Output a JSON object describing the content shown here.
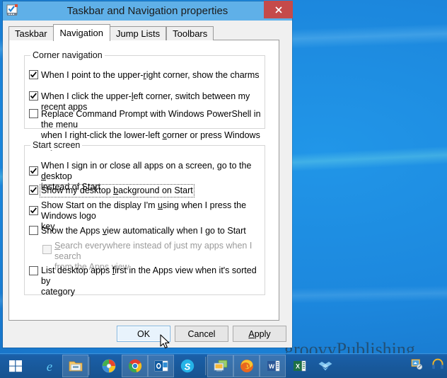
{
  "window": {
    "title": "Taskbar and Navigation properties",
    "app_icon": "taskbar-properties-icon",
    "close_label": "✕"
  },
  "tabs": [
    {
      "label": "Taskbar",
      "active": false
    },
    {
      "label": "Navigation",
      "active": true
    },
    {
      "label": "Jump Lists",
      "active": false
    },
    {
      "label": "Toolbars",
      "active": false
    }
  ],
  "groups": {
    "corner_navigation": {
      "title": "Corner navigation",
      "options": [
        {
          "name": "upper-right-charms",
          "pre": "When I point to the upper-",
          "mnemonic": "r",
          "post": "ight corner, show the charms",
          "checked": true,
          "enabled": true,
          "focused": false
        },
        {
          "name": "upper-left-switch-apps",
          "pre": "When I click the upper-",
          "mnemonic": "l",
          "post": "eft corner, switch between my recent apps",
          "checked": true,
          "enabled": true,
          "focused": false
        },
        {
          "name": "replace-command-prompt-powershell",
          "pre": "Replace Command Prompt with Windows PowerShell in the menu\nwhen I right-click the lower-left ",
          "mnemonic": "c",
          "post": "orner or press Windows key +X",
          "checked": false,
          "enabled": true,
          "focused": false
        }
      ]
    },
    "start_screen": {
      "title": "Start screen",
      "options": [
        {
          "name": "sign-in-go-to-desktop",
          "pre": "When I sign in or close all apps on a screen, go to the ",
          "mnemonic": "d",
          "post": "esktop\ninstead of Start",
          "checked": true,
          "enabled": true,
          "focused": false
        },
        {
          "name": "show-desktop-background-on-start",
          "pre": "Show my desktop ",
          "mnemonic": "b",
          "post": "ackground on Start",
          "checked": true,
          "enabled": true,
          "focused": true
        },
        {
          "name": "show-start-on-display-in-use",
          "pre": "Show Start on the display I'm ",
          "mnemonic": "u",
          "post": "sing when I press the Windows logo\nkey",
          "checked": true,
          "enabled": true,
          "focused": false
        },
        {
          "name": "show-apps-view-automatically",
          "pre": "Show the Apps ",
          "mnemonic": "v",
          "post": "iew automatically when I go to Start",
          "checked": false,
          "enabled": true,
          "focused": false
        },
        {
          "name": "search-everywhere",
          "pre": "",
          "mnemonic": "S",
          "post": "earch everywhere instead of just my apps when I search\nfrom the Apps view",
          "checked": false,
          "enabled": false,
          "focused": false,
          "indented": true
        },
        {
          "name": "list-desktop-apps-first",
          "pre": "List desktop apps ",
          "mnemonic": "f",
          "post": "irst in the Apps view when it's sorted by\ncategory",
          "checked": false,
          "enabled": true,
          "focused": false
        }
      ]
    }
  },
  "buttons": {
    "ok": "OK",
    "cancel": "Cancel",
    "apply_pre": "",
    "apply_mnemonic": "A",
    "apply_post": "pply"
  },
  "desktop": {
    "watermark": "groovyPublishing"
  },
  "taskbar": {
    "start_icon": "windows-start-icon",
    "items": [
      {
        "name": "internet-explorer-icon",
        "pinned": false
      },
      {
        "name": "file-explorer-icon",
        "pinned": true
      },
      {
        "name": "windows-media-center-icon",
        "pinned": false
      },
      {
        "name": "google-chrome-icon",
        "pinned": true
      },
      {
        "name": "outlook-icon",
        "pinned": true
      },
      {
        "name": "skype-icon",
        "pinned": false
      },
      {
        "name": "remote-desktop-icon",
        "pinned": true
      },
      {
        "name": "firefox-icon",
        "pinned": true
      },
      {
        "name": "word-icon",
        "pinned": true
      },
      {
        "name": "excel-icon",
        "pinned": false
      },
      {
        "name": "dropbox-icon",
        "pinned": false
      }
    ],
    "tray": [
      {
        "name": "tray-paint-icon"
      },
      {
        "name": "tray-headset-icon"
      }
    ]
  },
  "colors": {
    "window_frame": "#4ba0e2",
    "titlebar": "#5fb0e8",
    "close_button": "#c54a4a",
    "dialog_face": "#f0f0f0",
    "taskbar": "#17538f",
    "default_button_border": "#7eb4e0"
  }
}
